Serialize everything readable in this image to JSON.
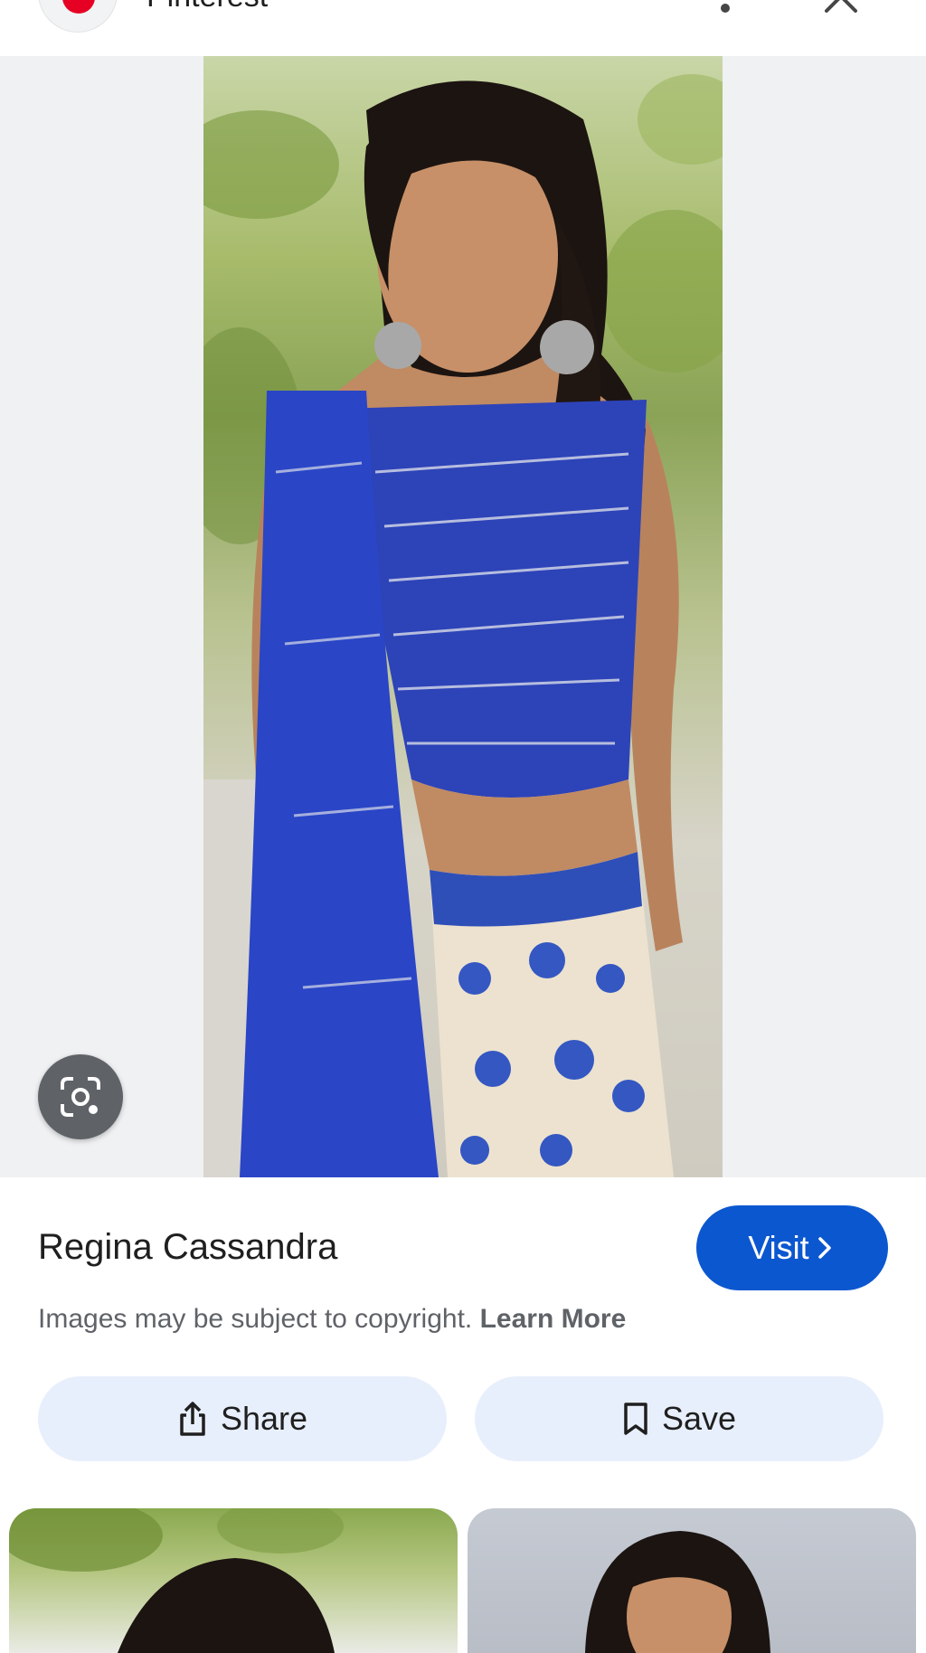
{
  "header": {
    "source_name": "Pinterest",
    "favicon_icon": "pinterest-logo",
    "more_icon": "more-vert-icon",
    "close_icon": "close-icon"
  },
  "image": {
    "lens_icon": "google-lens-icon"
  },
  "details": {
    "title": "Regina Cassandra",
    "visit_label": "Visit",
    "copyright_text": "Images may be subject to copyright.",
    "learn_more": "Learn More"
  },
  "actions": {
    "share_label": "Share",
    "save_label": "Save"
  },
  "colors": {
    "visit_button": "#0b57d0",
    "action_pill": "#e8effc",
    "viewer_background": "#f0f1f3",
    "pinterest_red": "#e60023"
  }
}
